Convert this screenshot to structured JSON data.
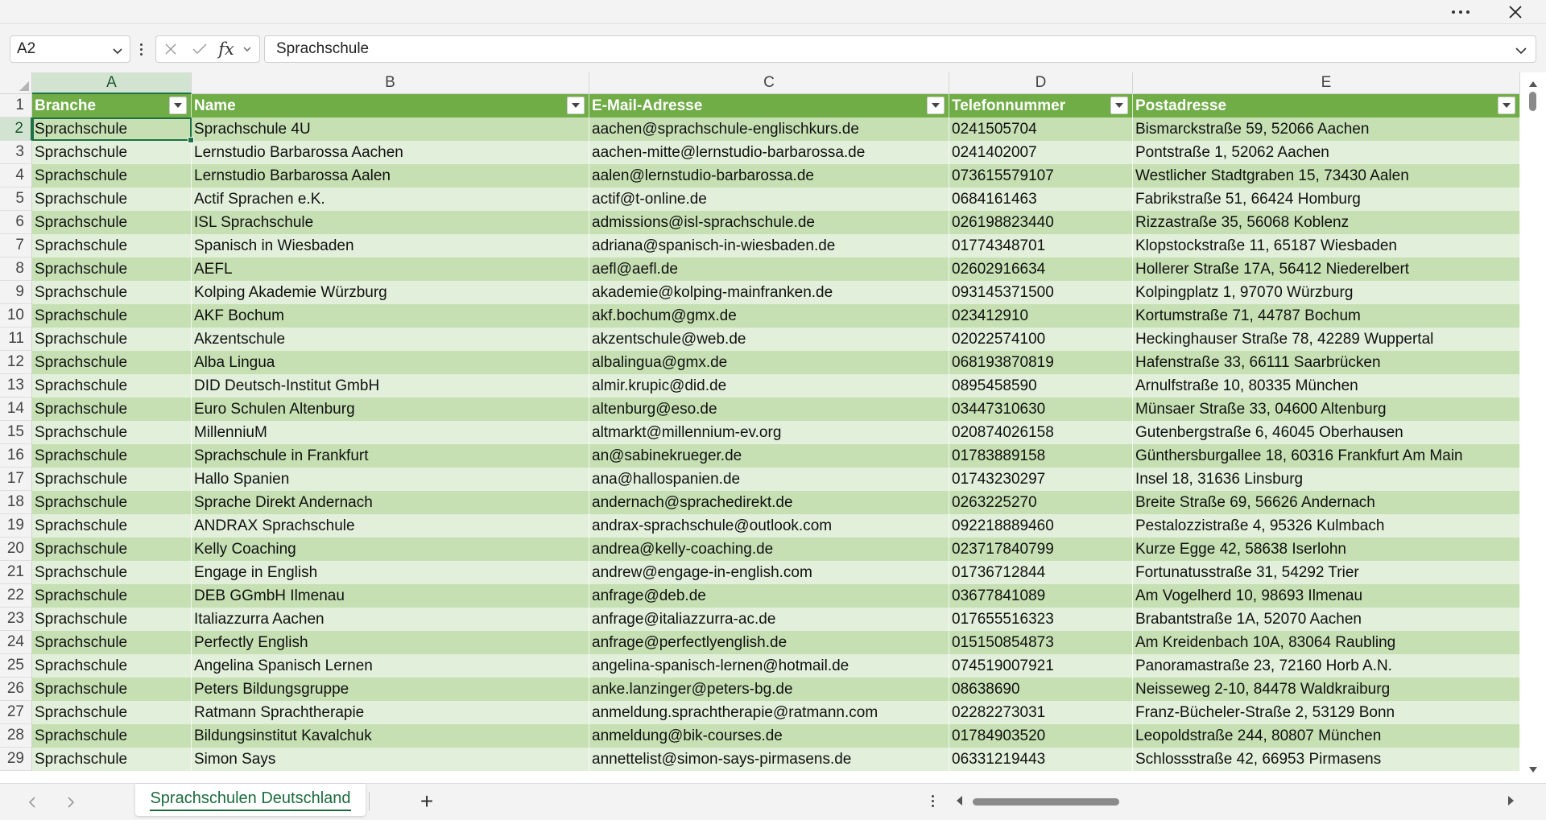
{
  "window": {
    "more_icon": "more-horizontal-icon",
    "close_icon": "close-icon"
  },
  "formula_bar": {
    "name_box": "A2",
    "formula_value": "Sprachschule",
    "fx_label": "fx"
  },
  "columns": [
    "A",
    "B",
    "C",
    "D",
    "E"
  ],
  "selected_column": "A",
  "selected_row": 2,
  "table": {
    "headers": [
      "Branche",
      "Name",
      "E-Mail-Adresse",
      "Telefonnummer",
      "Postadresse"
    ],
    "rows": [
      [
        "Sprachschule",
        "Sprachschule 4U",
        "aachen@sprachschule-englischkurs.de",
        "0241505704",
        "Bismarckstraße 59, 52066 Aachen"
      ],
      [
        "Sprachschule",
        "Lernstudio Barbarossa Aachen",
        "aachen-mitte@lernstudio-barbarossa.de",
        "0241402007",
        "Pontstraße 1, 52062 Aachen"
      ],
      [
        "Sprachschule",
        "Lernstudio Barbarossa Aalen",
        "aalen@lernstudio-barbarossa.de",
        "073615579107",
        "Westlicher Stadtgraben 15, 73430 Aalen"
      ],
      [
        "Sprachschule",
        "Actif Sprachen e.K.",
        "actif@t-online.de",
        "0684161463",
        "Fabrikstraße 51, 66424 Homburg"
      ],
      [
        "Sprachschule",
        "ISL Sprachschule",
        "admissions@isl-sprachschule.de",
        "026198823440",
        "Rizzastraße 35, 56068 Koblenz"
      ],
      [
        "Sprachschule",
        "Spanisch in Wiesbaden",
        "adriana@spanisch-in-wiesbaden.de",
        "01774348701",
        "Klopstockstraße 11, 65187 Wiesbaden"
      ],
      [
        "Sprachschule",
        "AEFL",
        "aefl@aefl.de",
        "02602916634",
        "Hollerer Straße 17A, 56412 Niederelbert"
      ],
      [
        "Sprachschule",
        "Kolping Akademie Würzburg",
        "akademie@kolping-mainfranken.de",
        "093145371500",
        "Kolpingplatz 1, 97070 Würzburg"
      ],
      [
        "Sprachschule",
        "AKF Bochum",
        "akf.bochum@gmx.de",
        "023412910",
        "Kortumstraße 71, 44787 Bochum"
      ],
      [
        "Sprachschule",
        "Akzentschule",
        "akzentschule@web.de",
        "02022574100",
        "Heckinghauser Straße 78, 42289 Wuppertal"
      ],
      [
        "Sprachschule",
        "Alba Lingua",
        "albalingua@gmx.de",
        "068193870819",
        "Hafenstraße 33, 66111 Saarbrücken"
      ],
      [
        "Sprachschule",
        "DID Deutsch-Institut GmbH",
        "almir.krupic@did.de",
        "0895458590",
        "Arnulfstraße 10, 80335 München"
      ],
      [
        "Sprachschule",
        "Euro Schulen Altenburg",
        "altenburg@eso.de",
        "03447310630",
        "Münsaer Straße 33, 04600 Altenburg"
      ],
      [
        "Sprachschule",
        "MillenniuM",
        "altmarkt@millennium-ev.org",
        "020874026158",
        "Gutenbergstraße 6, 46045 Oberhausen"
      ],
      [
        "Sprachschule",
        "Sprachschule in Frankfurt",
        "an@sabinekrueger.de",
        "01783889158",
        "Günthersburgallee 18, 60316 Frankfurt Am Main"
      ],
      [
        "Sprachschule",
        "Hallo Spanien",
        "ana@hallospanien.de",
        "01743230297",
        "Insel 18, 31636 Linsburg"
      ],
      [
        "Sprachschule",
        "Sprache Direkt Andernach",
        "andernach@sprachedirekt.de",
        "0263225270",
        "Breite Straße 69, 56626 Andernach"
      ],
      [
        "Sprachschule",
        "ANDRAX Sprachschule",
        "andrax-sprachschule@outlook.com",
        "092218889460",
        "Pestalozzistraße 4, 95326 Kulmbach"
      ],
      [
        "Sprachschule",
        "Kelly Coaching",
        "andrea@kelly-coaching.de",
        "023717840799",
        "Kurze Egge 42, 58638 Iserlohn"
      ],
      [
        "Sprachschule",
        "Engage in English",
        "andrew@engage-in-english.com",
        "01736712844",
        "Fortunatusstraße 31, 54292 Trier"
      ],
      [
        "Sprachschule",
        "DEB GGmbH Ilmenau",
        "anfrage@deb.de",
        "03677841089",
        "Am Vogelherd 10, 98693 Ilmenau"
      ],
      [
        "Sprachschule",
        "Italiazzurra Aachen",
        "anfrage@italiazzurra-ac.de",
        "017655516323",
        "Brabantstraße 1A, 52070 Aachen"
      ],
      [
        "Sprachschule",
        "Perfectly English",
        "anfrage@perfectlyenglish.de",
        "015150854873",
        "Am Kreidenbach 10A, 83064 Raubling"
      ],
      [
        "Sprachschule",
        "Angelina Spanisch Lernen",
        "angelina-spanisch-lernen@hotmail.de",
        "074519007921",
        "Panoramastraße 23, 72160 Horb A.N."
      ],
      [
        "Sprachschule",
        "Peters Bildungsgruppe",
        "anke.lanzinger@peters-bg.de",
        "08638690",
        "Neisseweg 2-10, 84478 Waldkraiburg"
      ],
      [
        "Sprachschule",
        "Ratmann Sprachtherapie",
        "anmeldung.sprachtherapie@ratmann.com",
        "02282273031",
        "Franz-Bücheler-Straße 2, 53129 Bonn"
      ],
      [
        "Sprachschule",
        "Bildungsinstitut Kavalchuk",
        "anmeldung@bik-courses.de",
        "01784903520",
        "Leopoldstraße 244, 80807 München"
      ],
      [
        "Sprachschule",
        "Simon Says",
        "annettelist@simon-says-pirmasens.de",
        "06331219443",
        "Schlossstraße 42, 66953 Pirmasens"
      ]
    ]
  },
  "sheet": {
    "active_tab": "Sprachschulen Deutschland",
    "add_label": "+"
  },
  "colors": {
    "header_green": "#70ad47",
    "band_dark": "#c6e0b4",
    "band_light": "#e2efda",
    "accent": "#1e7145"
  }
}
